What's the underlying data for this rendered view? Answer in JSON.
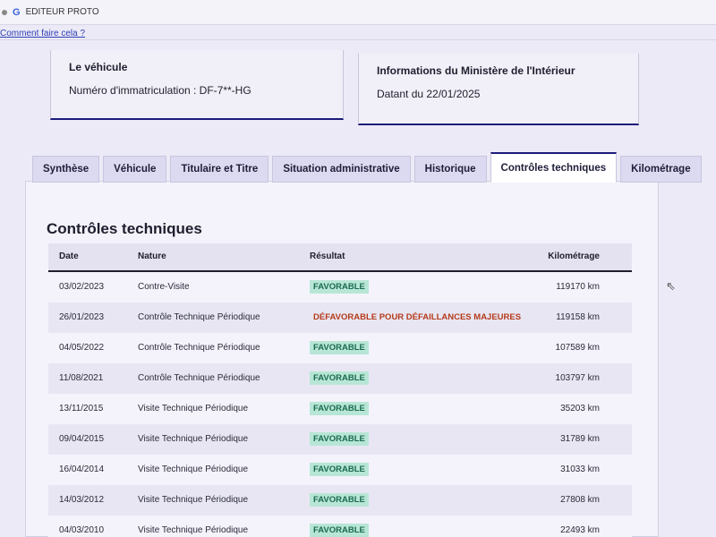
{
  "browser": {
    "tab_title": "EDITEUR PROTO",
    "help_link": "Comment faire cela ?"
  },
  "vehicle_card": {
    "title": "Le véhicule",
    "plate_line": "Numéro d'immatriculation : DF-7**-HG"
  },
  "ministry_card": {
    "title": "Informations du Ministère de l'Intérieur",
    "date_line": "Datant du 22/01/2025"
  },
  "tabs": [
    {
      "label": "Synthèse",
      "active": false
    },
    {
      "label": "Véhicule",
      "active": false
    },
    {
      "label": "Titulaire et Titre",
      "active": false
    },
    {
      "label": "Situation administrative",
      "active": false
    },
    {
      "label": "Historique",
      "active": false
    },
    {
      "label": "Contrôles techniques",
      "active": true
    },
    {
      "label": "Kilométrage",
      "active": false
    }
  ],
  "section_title": "Contrôles techniques",
  "table": {
    "headers": {
      "date": "Date",
      "nature": "Nature",
      "result": "Résultat",
      "km": "Kilométrage"
    },
    "rows": [
      {
        "date": "03/02/2023",
        "nature": "Contre-Visite",
        "result": "FAVORABLE",
        "km": "119170 km"
      },
      {
        "date": "26/01/2023",
        "nature": "Contrôle Technique Périodique",
        "result": "DÉFAVORABLE POUR DÉFAILLANCES MAJEURES",
        "km": "119158 km"
      },
      {
        "date": "04/05/2022",
        "nature": "Contrôle Technique Périodique",
        "result": "FAVORABLE",
        "km": "107589 km"
      },
      {
        "date": "11/08/2021",
        "nature": "Contrôle Technique Périodique",
        "result": "FAVORABLE",
        "km": "103797 km"
      },
      {
        "date": "13/11/2015",
        "nature": "Visite Technique Périodique",
        "result": "FAVORABLE",
        "km": "35203 km"
      },
      {
        "date": "09/04/2015",
        "nature": "Visite Technique Périodique",
        "result": "FAVORABLE",
        "km": "31789 km"
      },
      {
        "date": "16/04/2014",
        "nature": "Visite Technique Périodique",
        "result": "FAVORABLE",
        "km": "31033 km"
      },
      {
        "date": "14/03/2012",
        "nature": "Visite Technique Périodique",
        "result": "FAVORABLE",
        "km": "27808 km"
      },
      {
        "date": "04/03/2010",
        "nature": "Visite Technique Périodique",
        "result": "FAVORABLE",
        "km": "22493 km"
      }
    ]
  },
  "colors": {
    "accent": "#1b1b7a",
    "favorable_bg": "#b8e6d6",
    "favorable_text": "#1a6b4f",
    "defavorable_text": "#b53a1a"
  }
}
